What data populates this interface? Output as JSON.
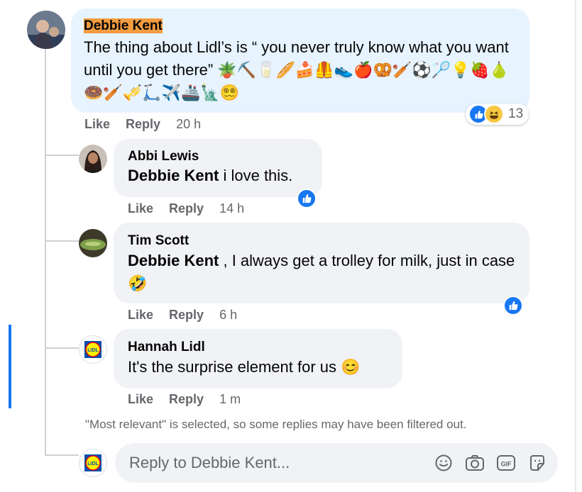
{
  "top_comment": {
    "author": "Debbie Kent",
    "text": "The thing about Lidl’s is “ you never truly know what you want until you get there” 🪴⛏️🥛🥖🍰🦺👟🍎🥨🏏⚽🏸💡🍓🍐🍩🏏🎺🛴✈️🚢🗽😵‍💫",
    "actions": {
      "like": "Like",
      "reply": "Reply",
      "time": "20 h"
    },
    "reaction_count": "13"
  },
  "replies": [
    {
      "author": "Abbi Lewis",
      "mention": "Debbie Kent",
      "text": " i love this.",
      "actions": {
        "like": "Like",
        "reply": "Reply",
        "time": "14 h"
      }
    },
    {
      "author": "Tim Scott",
      "mention": "Debbie Kent",
      "text": " , I always get a trolley for milk, just in case 🤣",
      "actions": {
        "like": "Like",
        "reply": "Reply",
        "time": "6 h"
      }
    },
    {
      "author": "Hannah Lidl",
      "text": "It's the surprise element for us 😊",
      "actions": {
        "like": "Like",
        "reply": "Reply",
        "time": "1 m"
      }
    }
  ],
  "notice": "\"Most relevant\" is selected, so some replies may have been filtered out.",
  "reply_box": {
    "placeholder": "Reply to Debbie Kent..."
  },
  "logo_text": "LIDL",
  "colors": {
    "accent": "#1877f2",
    "highlight": "#f39c40",
    "bubble": "#f0f2f5",
    "bubble_highlight": "#e7f3ff"
  },
  "icons": [
    "like-icon",
    "haha-icon",
    "emoji-icon",
    "camera-icon",
    "gif-icon",
    "sticker-icon"
  ]
}
